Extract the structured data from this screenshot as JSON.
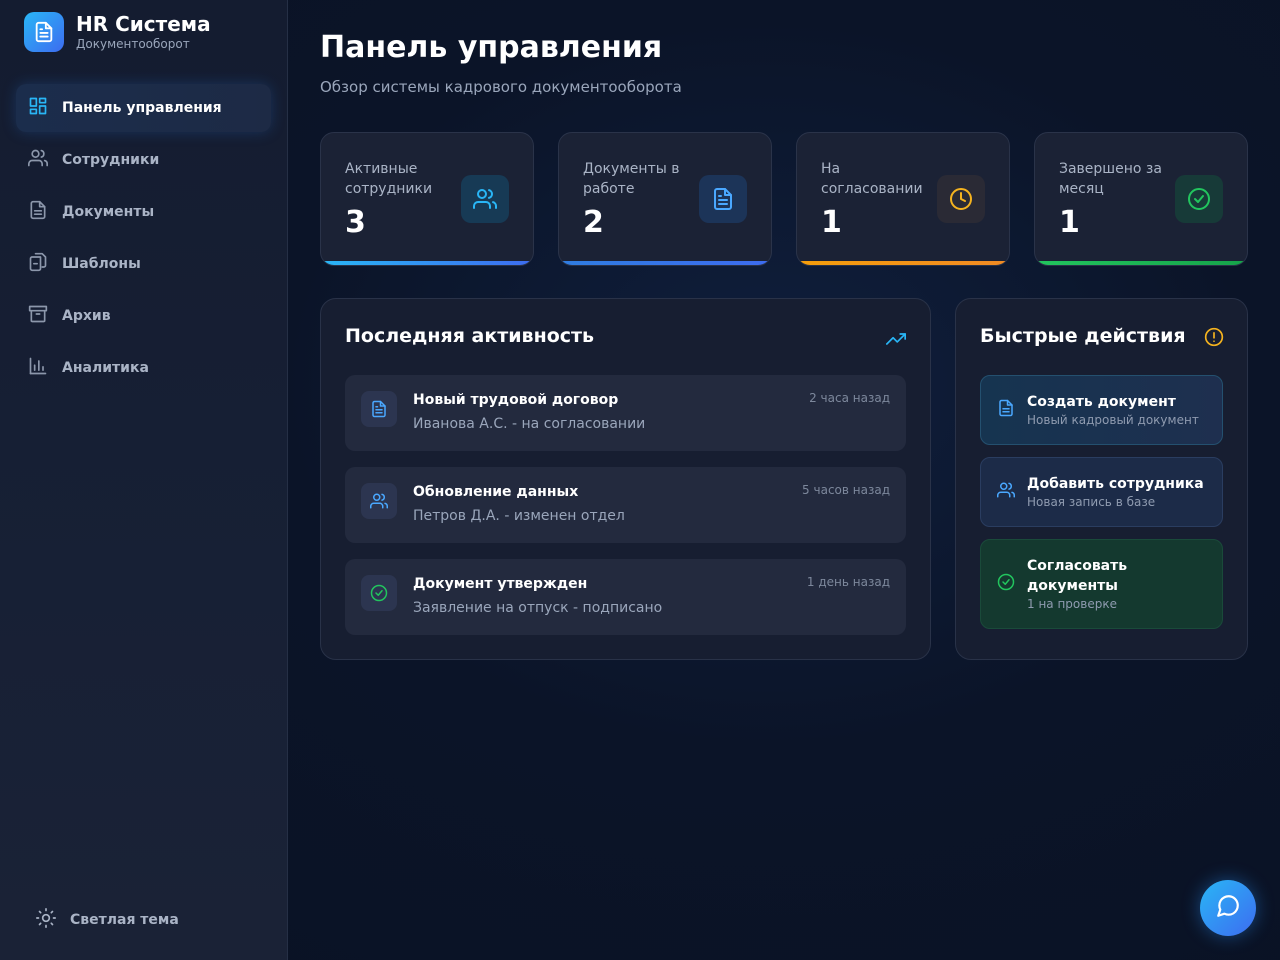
{
  "brand": {
    "title": "HR Система",
    "subtitle": "Документооборот",
    "icon": "document-icon"
  },
  "sidebar": {
    "items": [
      {
        "label": "Панель управления",
        "icon": "dashboard-icon",
        "active": true
      },
      {
        "label": "Сотрудники",
        "icon": "users-icon",
        "active": false
      },
      {
        "label": "Документы",
        "icon": "document-icon",
        "active": false
      },
      {
        "label": "Шаблоны",
        "icon": "templates-icon",
        "active": false
      },
      {
        "label": "Архив",
        "icon": "archive-icon",
        "active": false
      },
      {
        "label": "Аналитика",
        "icon": "analytics-icon",
        "active": false
      }
    ],
    "theme_toggle": {
      "label": "Светлая тема",
      "icon": "sun-icon"
    }
  },
  "header": {
    "title": "Панель управления",
    "subtitle": "Обзор системы кадрового документооборота"
  },
  "stats": [
    {
      "label": "Активные сотрудники",
      "value": "3",
      "icon": "users-icon",
      "accent": "#29b6f6"
    },
    {
      "label": "Документы в работе",
      "value": "2",
      "icon": "document-icon",
      "accent": "#3d7cf0"
    },
    {
      "label": "На согласовании",
      "value": "1",
      "icon": "clock-icon",
      "accent": "#f5a623"
    },
    {
      "label": "Завершено за месяц",
      "value": "1",
      "icon": "check-circle-icon",
      "accent": "#22c55e"
    }
  ],
  "activity": {
    "title": "Последняя активность",
    "icon": "trending-up-icon",
    "items": [
      {
        "title": "Новый трудовой договор",
        "desc": "Иванова А.С. - на согласовании",
        "time": "2 часа назад",
        "icon": "document-icon"
      },
      {
        "title": "Обновление данных",
        "desc": "Петров Д.А. - изменен отдел",
        "time": "5 часов назад",
        "icon": "users-icon"
      },
      {
        "title": "Документ утвержден",
        "desc": "Заявление на отпуск - подписано",
        "time": "1 день назад",
        "icon": "check-circle-icon"
      }
    ]
  },
  "quick_actions": {
    "title": "Быстрые действия",
    "icon": "alert-icon",
    "items": [
      {
        "title": "Создать документ",
        "sub": "Новый кадровый документ",
        "icon": "document-icon"
      },
      {
        "title": "Добавить сотрудника",
        "sub": "Новая запись в базе",
        "icon": "users-icon"
      },
      {
        "title": "Согласовать документы",
        "sub": "1 на проверке",
        "icon": "check-circle-icon"
      }
    ]
  },
  "fab": {
    "icon": "chat-icon"
  },
  "colors": {
    "accent": "#29b6f6",
    "warning": "#f5a623",
    "success": "#22c55e",
    "primary": "#3d6cf0"
  }
}
